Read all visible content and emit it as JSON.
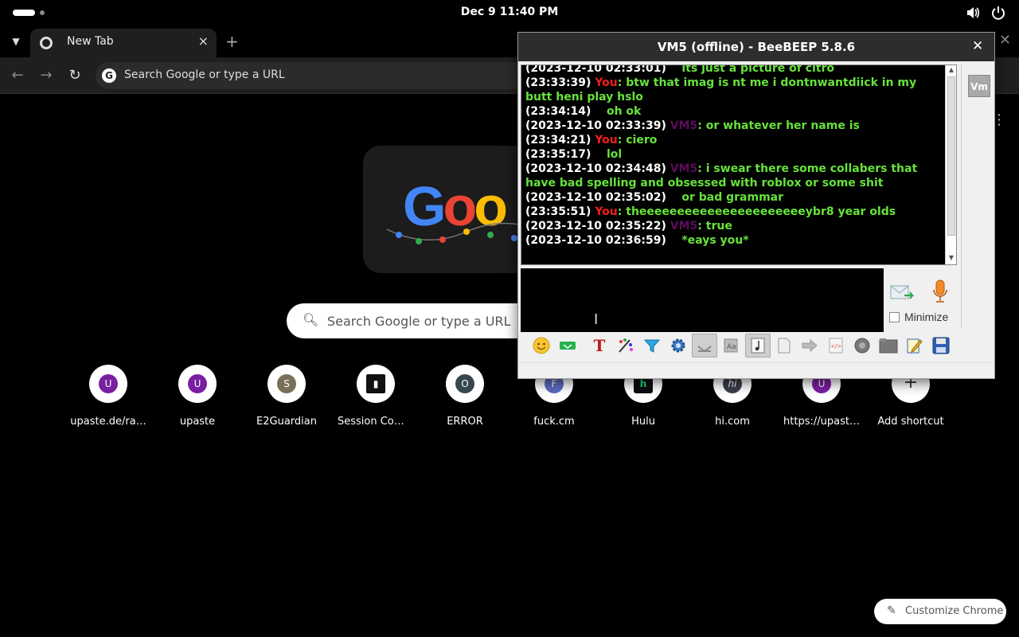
{
  "system_bar": {
    "clock": "Dec 9  11:40 PM",
    "icons": [
      "volume-icon",
      "power-icon"
    ]
  },
  "browser": {
    "tab": {
      "title": "New Tab",
      "close": "×"
    },
    "new_tab": "+",
    "window_close": "✕",
    "omnibox_placeholder": "Search Google or type a URL",
    "ntp": {
      "search_placeholder": "Search Google or type a URL",
      "doodle_text": "Goo",
      "shortcuts": [
        {
          "letter": "U",
          "label": "upaste.de/ra…",
          "color": "#7b1fa2"
        },
        {
          "letter": "U",
          "label": "upaste",
          "color": "#7b1fa2"
        },
        {
          "letter": "S",
          "label": "E2Guardian",
          "color": "#7a6f58"
        },
        {
          "letter": "",
          "label": "Session Com…",
          "color": "#111111"
        },
        {
          "letter": "O",
          "label": "ERROR",
          "color": "#37474f"
        },
        {
          "letter": "F",
          "label": "fuck.cm",
          "color": "#5c6bc0"
        },
        {
          "letter": "h",
          "label": "Hulu",
          "color": "#0b0c0f"
        },
        {
          "letter": "hi",
          "label": "hi.com",
          "color": "#3a3f4a"
        },
        {
          "letter": "U",
          "label": "https://upast…",
          "color": "#7b1fa2"
        },
        {
          "letter": "+",
          "label": "Add shortcut",
          "color": "#ffffff"
        }
      ],
      "customize_label": "Customize Chrome"
    }
  },
  "beebeep": {
    "title": "VM5 (offline) - BeeBEEP 5.8.6",
    "close": "✕",
    "badge": "Vm",
    "messages": [
      {
        "ts": "(2023-12-10 02:33:01)",
        "who": "",
        "sep": "   ",
        "text": "its just a picture of citro"
      },
      {
        "ts": "(23:33:39)",
        "who": "You",
        "sep": ": ",
        "text": "btw that imag is nt me i dontnwantdiick in my butt heni play hslo"
      },
      {
        "ts": "(23:34:14)",
        "who": "",
        "sep": "   ",
        "text": "oh ok"
      },
      {
        "ts": "(2023-12-10 02:33:39)",
        "who": "VM5",
        "sep": ": ",
        "text": "or whatever her name is"
      },
      {
        "ts": "(23:34:21)",
        "who": "You",
        "sep": ": ",
        "text": "ciero"
      },
      {
        "ts": "(23:35:17)",
        "who": "",
        "sep": "   ",
        "text": "lol"
      },
      {
        "ts": "(2023-12-10 02:34:48)",
        "who": "VM5",
        "sep": ": ",
        "text": "i swear there some collabers that have bad spelling and obsessed with roblox or some shit"
      },
      {
        "ts": "(2023-12-10 02:35:02)",
        "who": "",
        "sep": "   ",
        "text": "or bad grammar"
      },
      {
        "ts": "(23:35:51)",
        "who": "You",
        "sep": ": ",
        "text": "theeeeeeeeeeeeeeeeeeeeeeybr8 year olds"
      },
      {
        "ts": "(2023-12-10 02:35:22)",
        "who": "VM5",
        "sep": ": ",
        "text": "true"
      },
      {
        "ts": "(2023-12-10 02:36:59)",
        "who": "",
        "sep": "   ",
        "text": "*eays you*"
      }
    ],
    "minimize_label": "Minimize",
    "toolbar_icons": [
      "emoticon-icon",
      "green-bar-icon",
      "font-icon",
      "color-palette-icon",
      "filter-icon",
      "settings-gear-icon",
      "save-down-icon",
      "spell-icon",
      "music-note-icon",
      "file-icon",
      "forward-icon",
      "html-code-icon",
      "screenshot-icon",
      "folder-icon",
      "edit-note-icon",
      "floppy-save-icon"
    ]
  }
}
